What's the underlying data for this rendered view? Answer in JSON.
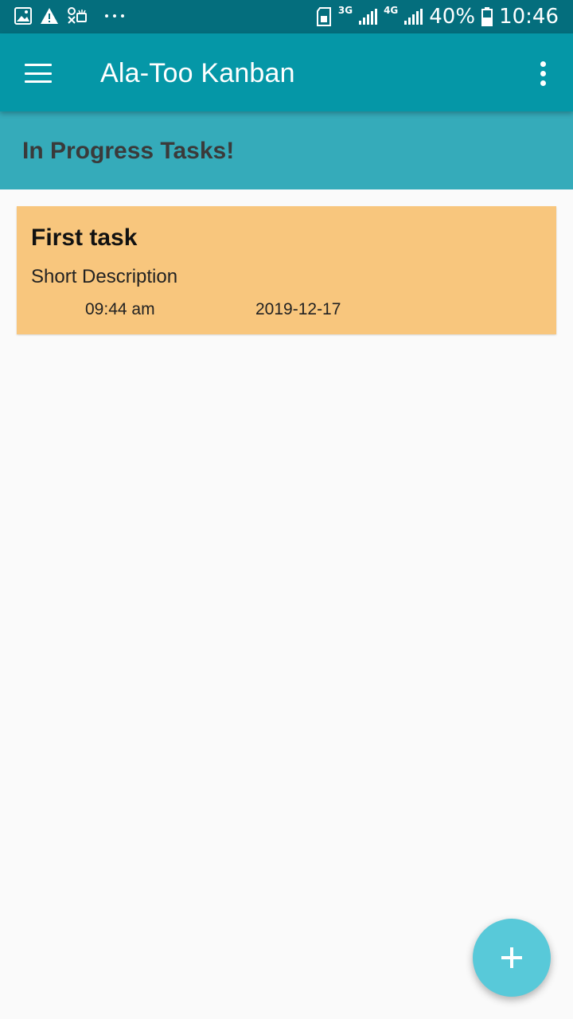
{
  "status_bar": {
    "left_icons": [
      "gallery-icon",
      "warning-icon",
      "notification-icon",
      "more-dots-icon"
    ],
    "network_1": "3G",
    "network_2": "4G",
    "battery": "40%",
    "time": "10:46"
  },
  "app_bar": {
    "title": "Ala-Too Kanban",
    "menu_icon": "hamburger-menu-icon",
    "overflow_icon": "more-vertical-icon"
  },
  "section": {
    "title": "In Progress Tasks!"
  },
  "tasks": [
    {
      "title": "First task",
      "description": "Short Description",
      "time": "09:44 am",
      "date": "2019-12-17"
    }
  ],
  "fab": {
    "icon": "plus-icon"
  },
  "colors": {
    "status_bar": "#046e7d",
    "app_bar": "#0597a7",
    "section_header": "#35abba",
    "task_card": "#f8c67d",
    "fab": "#58c9d9",
    "background": "#fafafa"
  }
}
